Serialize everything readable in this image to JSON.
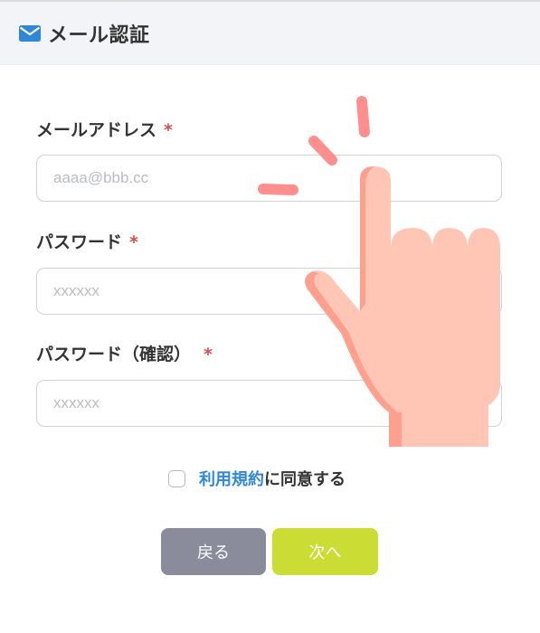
{
  "header": {
    "title": "メール認証",
    "icon": "envelope-icon"
  },
  "form": {
    "email": {
      "label": "メールアドレス",
      "required_mark": "*",
      "placeholder": "aaaa@bbb.cc",
      "value": ""
    },
    "password": {
      "label": "パスワード",
      "required_mark": "*",
      "placeholder": "xxxxxx",
      "value": ""
    },
    "password_confirm": {
      "label": "パスワード（確認）",
      "required_mark": "*",
      "placeholder": "xxxxxx",
      "value": ""
    },
    "agreement": {
      "checked": false,
      "terms_link": "利用規約",
      "text": "に同意する"
    }
  },
  "buttons": {
    "back": "戻る",
    "next": "次へ"
  },
  "overlay": {
    "icon": "tap-hand-icon"
  },
  "colors": {
    "accent_link": "#2f87d8",
    "required": "#e04b4b",
    "back_button": "#8a8c9b",
    "next_button": "#cbdd35",
    "header_bg": "#f2f4f7",
    "hand_skin": "#ffc6b5",
    "hand_shadow": "#ff9f8e",
    "tap_marks": "#ff8f8f"
  }
}
